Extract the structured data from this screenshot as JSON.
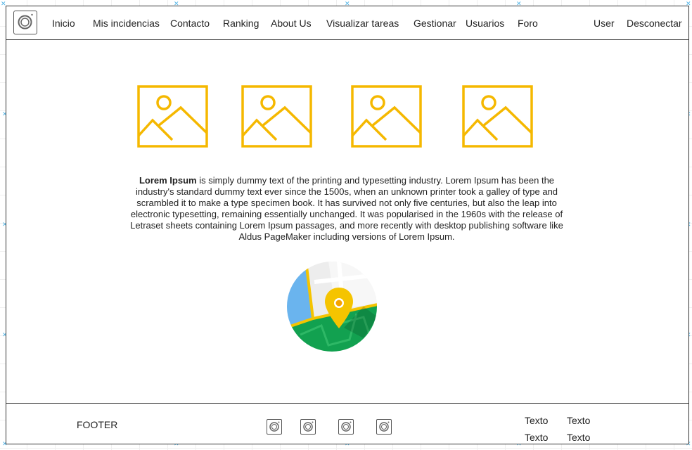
{
  "nav": {
    "items": [
      "Inicio",
      "Mis incidencias",
      "Contacto",
      "Ranking",
      "About Us",
      "Visualizar tareas",
      "Gestionar",
      "Usuarios",
      "Foro"
    ],
    "user_label": "User",
    "logout_label": "Desconectar"
  },
  "gallery": {
    "image_count": 4,
    "icon": "image-placeholder-icon",
    "accent_color": "#F5B800"
  },
  "content": {
    "lead_bold": "Lorem Ipsum",
    "body": " is simply dummy text of the printing and typesetting industry. Lorem Ipsum has been the industry's standard dummy text ever since the 1500s, when an unknown printer took a galley of type and scrambled it to make a type specimen book. It has survived not only five centuries, but also the leap into electronic typesetting, remaining essentially unchanged. It was popularised in the 1960s with the release of Letraset sheets containing Lorem Ipsum passages, and more recently with desktop publishing software like Aldus PageMaker including versions of Lorem Ipsum."
  },
  "map": {
    "icon": "map-location-icon",
    "pin_color": "#F5C400",
    "land_color": "#12A150",
    "water_color": "#6AB4EE"
  },
  "footer": {
    "title": "FOOTER",
    "social_icon_count": 4,
    "links": [
      [
        "Texto",
        "Texto"
      ],
      [
        "Texto",
        "Texto"
      ]
    ]
  }
}
